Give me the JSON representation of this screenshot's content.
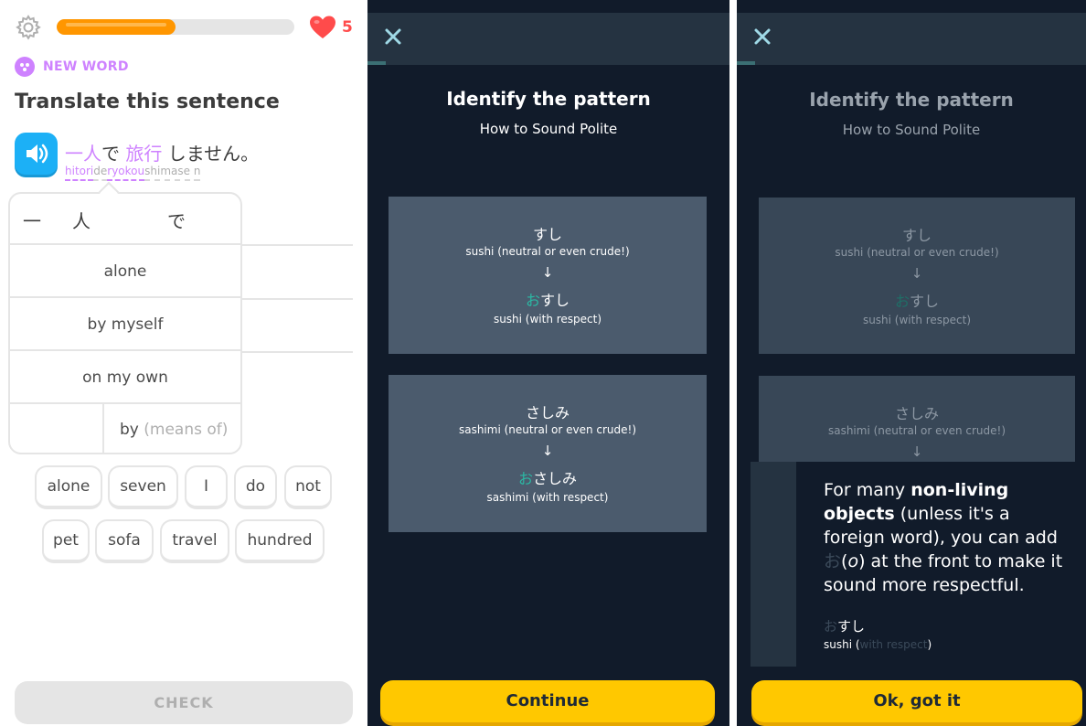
{
  "screen1": {
    "progress_fraction": 0.5,
    "hearts": "5",
    "badge_label": "NEW WORD",
    "title": "Translate this sentence",
    "sentence": {
      "w1": "一人",
      "w2": "で",
      "w3": "旅行",
      "w4": "しません。"
    },
    "romaji": {
      "r1": "hitori",
      "r2": "de",
      "r3": "ryokou",
      "r4": "shimase",
      "r5": "n"
    },
    "popup": {
      "header": [
        "一",
        "人",
        "で"
      ],
      "options": [
        "alone",
        "by myself",
        "on my own"
      ],
      "last": {
        "main": "by",
        "hint": "(means of)"
      }
    },
    "word_bank": [
      "alone",
      "seven",
      "I",
      "do",
      "not",
      "pet",
      "sofa",
      "travel",
      "hundred"
    ],
    "check_label": "CHECK",
    "colors": {
      "accent": "#ce82ff",
      "progress": "#ff9600",
      "heart": "#ff4b4b",
      "speaker": "#1cb0f6"
    }
  },
  "screen2": {
    "title": "Identify the pattern",
    "subtitle": "How to Sound Polite",
    "cards": [
      {
        "word": "すし",
        "neutral": "sushi (neutral or even crude!)",
        "arrow": "↓",
        "prefix": "お",
        "polite": "すし",
        "respect": "sushi  (with respect)"
      },
      {
        "word": "さしみ",
        "neutral": "sashimi (neutral or even crude!)",
        "arrow": "↓",
        "prefix": "お",
        "polite": "さしみ",
        "respect": "sashimi (with respect)"
      }
    ],
    "button": "Continue"
  },
  "screen3": {
    "title": "Identify the pattern",
    "subtitle": "How to Sound Polite",
    "cards": [
      {
        "word": "すし",
        "neutral": "sushi (neutral or even crude!)",
        "arrow": "↓",
        "prefix": "お",
        "polite": "すし",
        "respect": "sushi  (with respect)"
      },
      {
        "word": "さしみ",
        "neutral": "sashimi (neutral or even crude!)",
        "arrow": "↓"
      }
    ],
    "tip": {
      "t1": "For many ",
      "t2": "non-living objects",
      "t3": " (unless it's a foreign word), you can add ",
      "t4": "お",
      "t5": "(",
      "t6": "o",
      "t7": ") at the front to make it sound more respectful.",
      "jp_prefix": "お",
      "jp_rest": "すし",
      "en_start": "sushi (",
      "en_faint": "with respect",
      "en_end": ")"
    },
    "button": "Ok, got it"
  }
}
